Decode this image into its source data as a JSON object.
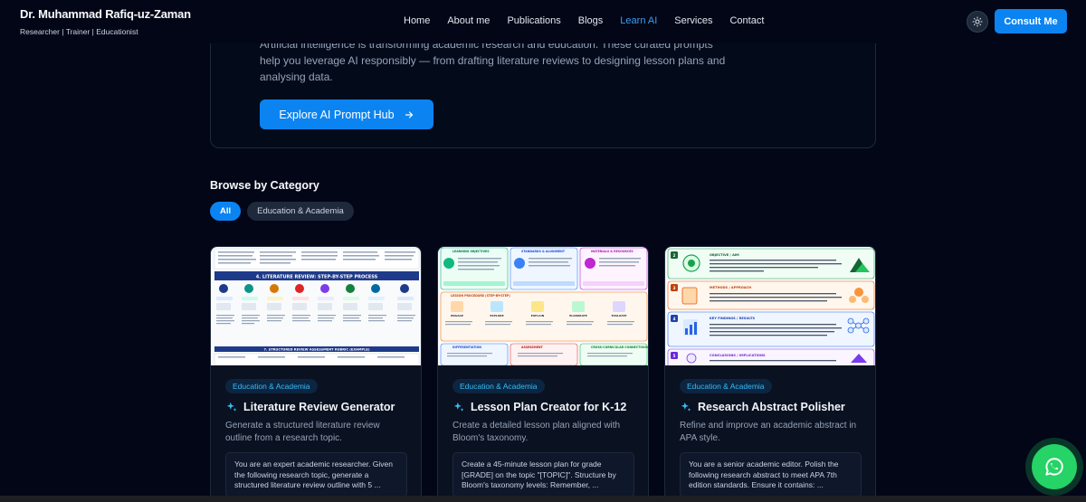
{
  "nav": {
    "brand_name": "Dr. Muhammad Rafiq-uz-Zaman",
    "brand_subtitle": "Researcher | Trainer | Educationist",
    "links": [
      "Home",
      "About me",
      "Publications",
      "Blogs",
      "Learn AI",
      "Services",
      "Contact"
    ],
    "active_link": "Learn AI",
    "theme_icon": "sun-icon",
    "cta_label": "Consult Me"
  },
  "hero": {
    "text": "Artificial intelligence is transforming academic research and education. These curated prompts help you leverage AI responsibly — from drafting literature reviews to designing lesson plans and analysing data.",
    "button_label": "Explore AI Prompt Hub",
    "button_icon": "arrow-right-icon"
  },
  "browse": {
    "title": "Browse by Category",
    "chips": [
      "All",
      "Education & Academia"
    ],
    "active_chip": "All"
  },
  "cards": [
    {
      "tag": "Education & Academia",
      "title": "Literature Review Generator",
      "description": "Generate a structured literature review outline from a research topic.",
      "prompt": "You are an expert academic researcher. Given the following research topic, generate a structured literature review outline with 5 ...",
      "thumb_heading": "4. LITERATURE REVIEW: STEP-BY-STEP PROCESS",
      "thumb_footer": "7. STRUCTURED REVIEW ASSESSMENT RUBRIC (EXAMPLE)"
    },
    {
      "tag": "Education & Academia",
      "title": "Lesson Plan Creator for K-12",
      "description": "Create a detailed lesson plan aligned with Bloom's taxonomy.",
      "prompt": "Create a 45-minute lesson plan for grade [GRADE] on the topic \"[TOPIC]\". Structure by Bloom's taxonomy levels: Remember, ...",
      "thumb_sections": [
        "LEARNING OBJECTIVES",
        "STANDARDS & ALIGNMENT",
        "MATERIALS & RESOURCES",
        "LESSON PROCEDURE (STEP-BY-STEP)",
        "DIFFERENTIATION",
        "ASSESSMENT",
        "CROSS-CURRICULAR CONNECTIONS"
      ],
      "thumb_steps": [
        "ENGAGE",
        "EXPLORE",
        "EXPLAIN",
        "ELABORATE",
        "EVALUATE"
      ]
    },
    {
      "tag": "Education & Academia",
      "title": "Research Abstract Polisher",
      "description": "Refine and improve an academic abstract in APA style.",
      "prompt": "You are a senior academic editor. Polish the following research abstract to meet APA 7th edition standards. Ensure it contains: ...",
      "thumb_sections": [
        {
          "num": "2",
          "title": "OBJECTIVE / AIM"
        },
        {
          "num": "3",
          "title": "METHODS / APPROACH"
        },
        {
          "num": "4",
          "title": "KEY FINDINGS / RESULTS"
        },
        {
          "num": "5",
          "title": "CONCLUSIONS / IMPLICATIONS"
        }
      ]
    }
  ],
  "colors": {
    "background": "#020617",
    "accent": "#0b84f2",
    "tag_text": "#38bdf8",
    "whatsapp": "#25d366"
  },
  "whatsapp_icon": "whatsapp-icon"
}
